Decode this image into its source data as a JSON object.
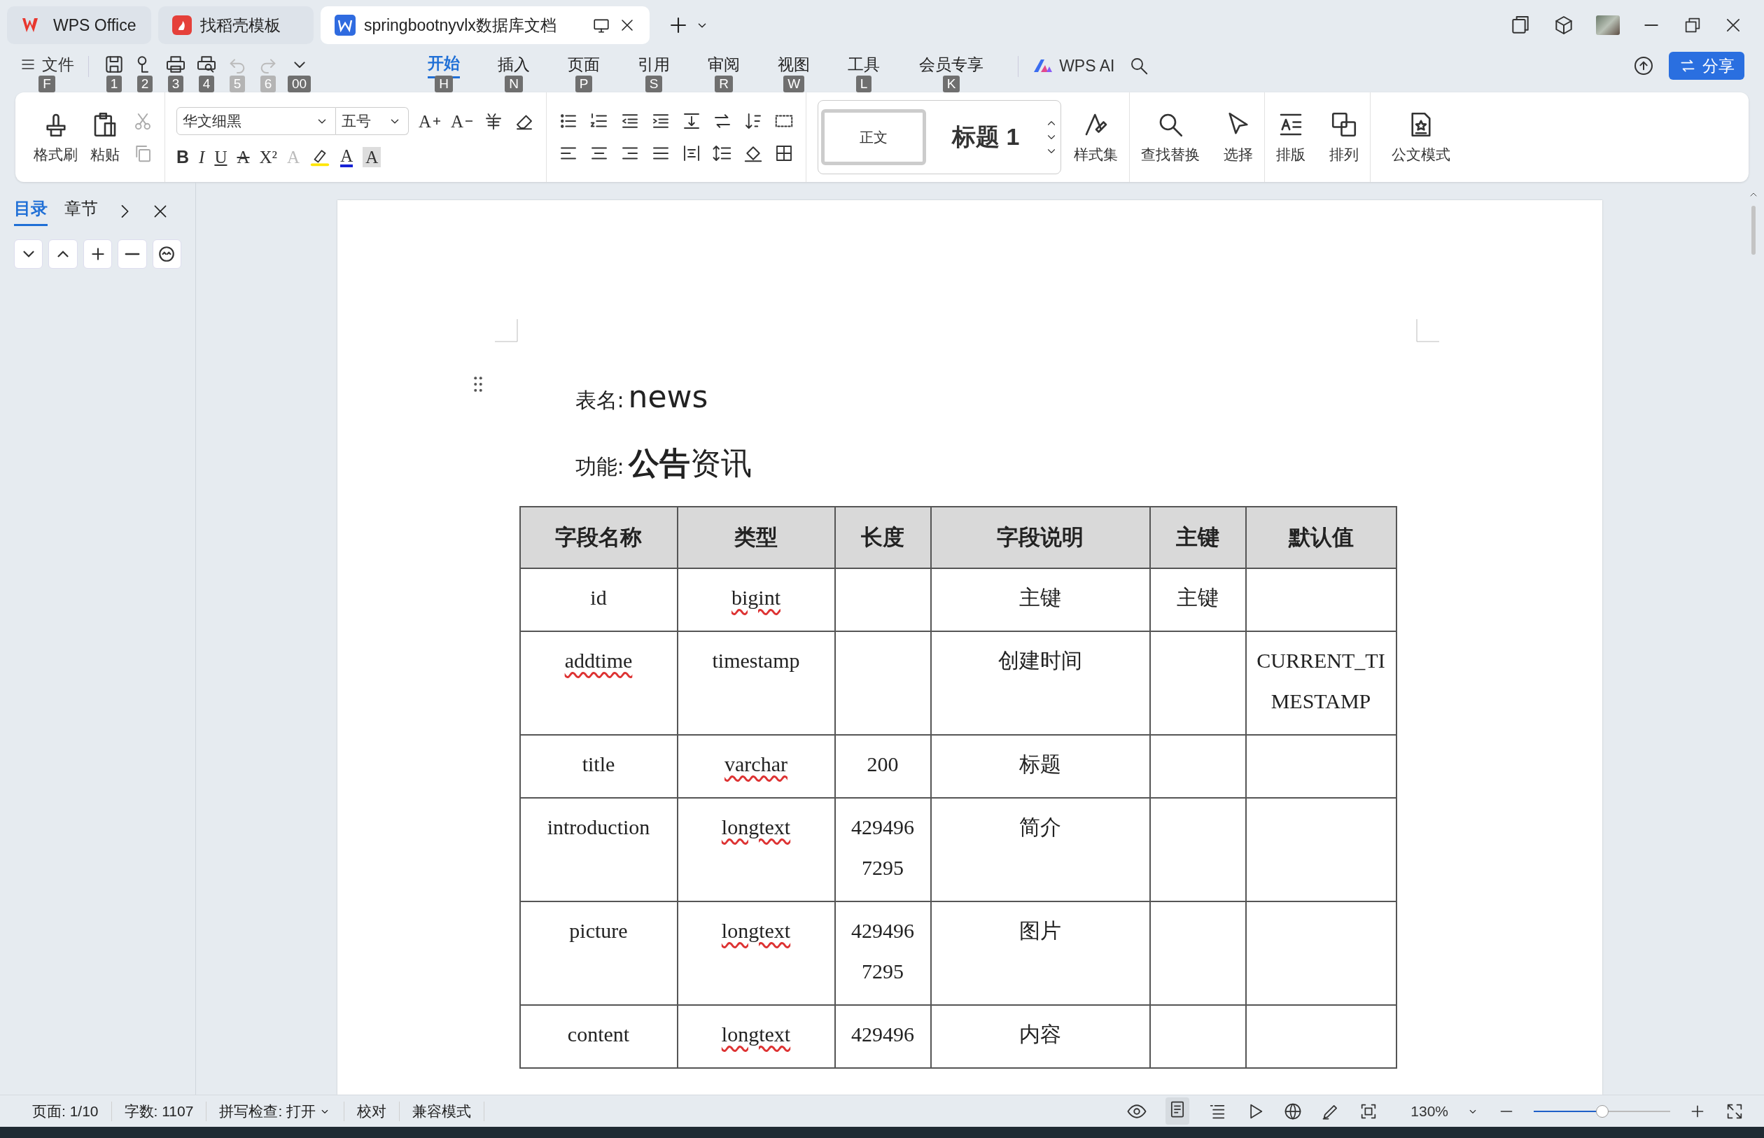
{
  "tabs": [
    {
      "label": "WPS Office",
      "kind": "home",
      "selected": false
    },
    {
      "label": "找稻壳模板",
      "kind": "docer",
      "selected": false
    },
    {
      "label": "springbootnyvlx数据库文档",
      "kind": "writer",
      "selected": true
    }
  ],
  "menu": {
    "file": {
      "label": "文件",
      "key": "F"
    },
    "quick_keys": [
      {
        "key": "1",
        "disabled": false
      },
      {
        "key": "2",
        "disabled": false
      },
      {
        "key": "3",
        "disabled": false
      },
      {
        "key": "4",
        "disabled": false
      },
      {
        "key": "5",
        "disabled": true
      },
      {
        "key": "6",
        "disabled": true
      },
      {
        "key": "00",
        "disabled": false
      }
    ],
    "tabs": [
      {
        "label": "开始",
        "key": "H",
        "selected": true
      },
      {
        "label": "插入",
        "key": "N",
        "selected": false
      },
      {
        "label": "页面",
        "key": "P",
        "selected": false
      },
      {
        "label": "引用",
        "key": "S",
        "selected": false
      },
      {
        "label": "审阅",
        "key": "R",
        "selected": false
      },
      {
        "label": "视图",
        "key": "W",
        "selected": false
      },
      {
        "label": "工具",
        "key": "L",
        "selected": false
      },
      {
        "label": "会员专享",
        "key": "K",
        "selected": false
      }
    ],
    "ai": "WPS AI",
    "share": "分享"
  },
  "ribbon": {
    "format_painter": "格式刷",
    "paste": "粘贴",
    "font": "华文细黑",
    "size": "五号",
    "size_glyphs": [
      {
        "glyph": "A",
        "kind": "grow"
      },
      {
        "glyph": "A",
        "kind": "shrink"
      }
    ],
    "font_glyphs": [
      {
        "glyph": "B",
        "kind": "bold"
      },
      {
        "glyph": "I",
        "kind": "italic"
      },
      {
        "glyph": "U",
        "kind": "underline"
      },
      {
        "glyph": "A",
        "kind": "strike"
      },
      {
        "glyph": "X²",
        "kind": "super"
      },
      {
        "glyph": "A",
        "kind": "effect"
      },
      {
        "glyph": "A",
        "kind": "color"
      },
      {
        "glyph": "A",
        "kind": "shade"
      }
    ],
    "styles": [
      {
        "label": "正文",
        "selected": true
      },
      {
        "label": "标题 1",
        "selected": false
      }
    ],
    "tools": [
      "样式集",
      "查找替换",
      "选择",
      "排版",
      "排列",
      "公文模式"
    ]
  },
  "sidebar": {
    "tabs": [
      {
        "label": "目录",
        "selected": true
      },
      {
        "label": "章节",
        "selected": false
      }
    ]
  },
  "document": {
    "table_name_label": "表名:",
    "table_name": "news",
    "function_label": "功能:",
    "function": "**公告**资讯",
    "table": {
      "columns": [
        "字段名称",
        "类型",
        "长度",
        "字段说明",
        "主键",
        "默认值"
      ],
      "rows": [
        {
          "cells": [
            {
              "text": "id",
              "misspelled": false
            },
            {
              "text": "bigint",
              "misspelled": true
            },
            null,
            {
              "text": "主键",
              "misspelled": false
            },
            {
              "text": "主键",
              "misspelled": false
            },
            null
          ]
        },
        {
          "cells": [
            {
              "text": "addtime",
              "misspelled": true
            },
            {
              "text": "timestamp",
              "misspelled": false
            },
            null,
            {
              "text": "创建时间",
              "misspelled": false
            },
            null,
            {
              "text": "CURRENT_TIMESTAMP",
              "misspelled": false
            }
          ]
        },
        {
          "cells": [
            {
              "text": "title",
              "misspelled": false
            },
            {
              "text": "varchar",
              "misspelled": true
            },
            {
              "text": "200",
              "misspelled": false
            },
            {
              "text": "标题",
              "misspelled": false
            },
            null,
            null
          ]
        },
        {
          "cells": [
            {
              "text": "introduction",
              "misspelled": false
            },
            {
              "text": "longtext",
              "misspelled": true
            },
            {
              "text": "4294967295",
              "misspelled": false
            },
            {
              "text": "简介",
              "misspelled": false
            },
            null,
            null
          ]
        },
        {
          "cells": [
            {
              "text": "picture",
              "misspelled": false
            },
            {
              "text": "longtext",
              "misspelled": true
            },
            {
              "text": "4294967295",
              "misspelled": false
            },
            {
              "text": "图片",
              "misspelled": false
            },
            null,
            null
          ]
        },
        {
          "cells": [
            {
              "text": "content",
              "misspelled": false
            },
            {
              "text": "longtext",
              "misspelled": true
            },
            {
              "text": "429496",
              "misspelled": false
            },
            {
              "text": "内容",
              "misspelled": false
            },
            null,
            null
          ]
        }
      ]
    }
  },
  "status": {
    "items": [
      {
        "label": "页面: 1/10",
        "dropdown": false
      },
      {
        "label": "字数: 1107",
        "dropdown": false
      },
      {
        "label": "拼写检查: 打开",
        "dropdown": true
      },
      {
        "label": "校对",
        "dropdown": false
      },
      {
        "label": "兼容模式",
        "dropdown": false
      }
    ],
    "zoom": {
      "label": "130%",
      "level": 0.5
    }
  }
}
